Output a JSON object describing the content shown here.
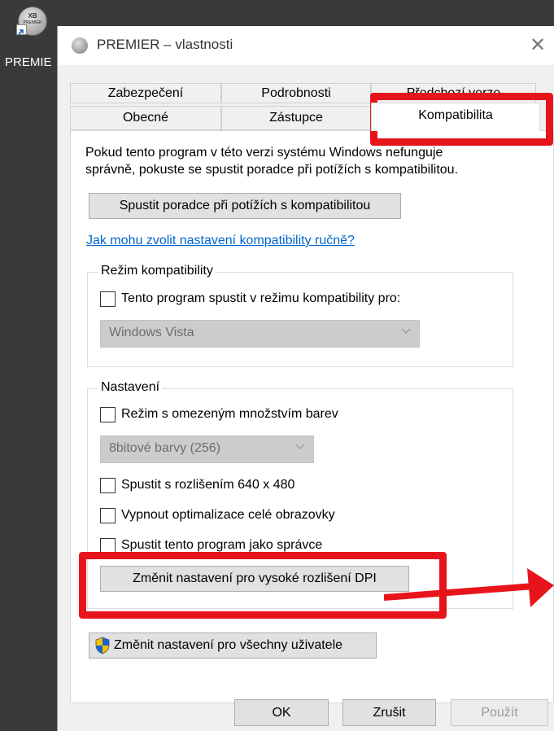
{
  "desktop": {
    "icon_label": "PREMIE",
    "icon_text_top": "XB",
    "icon_text_bottom": "PREMIER"
  },
  "dialog": {
    "title": "PREMIER – vlastnosti",
    "close_glyph": "✕",
    "tabs_top": [
      "Zabezpečení",
      "Podrobnosti",
      "Předchozí verze"
    ],
    "tabs_bottom": [
      "Obecné",
      "Zástupce",
      "Kompatibilita"
    ],
    "active_tab": "Kompatibilita",
    "intro_line1": "Pokud tento program v této verzi systému Windows nefunguje",
    "intro_line2": "správně, pokuste se spustit poradce při potížích s kompatibilitou.",
    "troubleshoot_button": "Spustit poradce při potížích s kompatibilitou",
    "help_link": "Jak mohu zvolit nastavení kompatibility ručně?",
    "compat_group": {
      "legend": "Režim kompatibility",
      "checkbox_label": "Tento program spustit v režimu kompatibility pro:",
      "checked": false,
      "select_value": "Windows Vista"
    },
    "settings_group": {
      "legend": "Nastavení",
      "reduced_color": {
        "label": "Režim s omezeným množstvím barev",
        "checked": false
      },
      "color_select_value": "8bitové barvy (256)",
      "res_640": {
        "label": "Spustit s rozlišením 640 x 480",
        "checked": false
      },
      "disable_fullscreen": {
        "label": "Vypnout optimalizace celé obrazovky",
        "checked": false
      },
      "run_as_admin": {
        "label": "Spustit tento program jako správce",
        "checked": false
      },
      "dpi_button": "Změnit nastavení pro vysoké rozlišení DPI"
    },
    "all_users_button": "Změnit nastavení pro všechny uživatele",
    "footer": {
      "ok": "OK",
      "cancel": "Zrušit",
      "apply": "Použít"
    }
  },
  "colors": {
    "highlight": "#e8141c",
    "link": "#0066cc",
    "panel": "#ffffff",
    "dialog_bg": "#f0f0f0"
  },
  "icons": [
    "premier-app-icon",
    "shortcut-arrow-icon",
    "close-icon",
    "chevron-down-icon",
    "uac-shield-icon"
  ]
}
